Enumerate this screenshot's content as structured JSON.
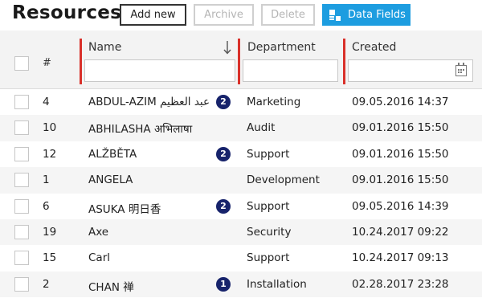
{
  "toolbar": {
    "title": "Resources",
    "add_label": "Add new",
    "archive_label": "Archive",
    "delete_label": "Delete",
    "fields_label": "Data Fields",
    "fields_icon": "data-fields-icon",
    "accent": "#1d9de0"
  },
  "table": {
    "columns": {
      "id": "#",
      "name": "Name",
      "department": "Department",
      "created": "Created"
    },
    "sort": {
      "column": "Name",
      "direction": "descending",
      "icon": "arrow-down-icon"
    },
    "filters": {
      "name": "",
      "department": "",
      "created": "",
      "created_icon": "calendar-icon"
    },
    "separator_color": "#d9302a",
    "badge_color": "#17236b",
    "rows": [
      {
        "id": "4",
        "name": "ABDUL-AZIM عبد العظيم",
        "badge": "2",
        "department": "Marketing",
        "created": "09.05.2016 14:37"
      },
      {
        "id": "10",
        "name": "ABHILASHA अभिलाषा",
        "badge": "",
        "department": "Audit",
        "created": "09.01.2016 15:50"
      },
      {
        "id": "12",
        "name": "ALŽBĚTA",
        "badge": "2",
        "department": "Support",
        "created": "09.01.2016 15:50"
      },
      {
        "id": "1",
        "name": "ANGELA",
        "badge": "",
        "department": "Development",
        "created": "09.01.2016 15:50"
      },
      {
        "id": "6",
        "name": "ASUKA 明日香",
        "badge": "2",
        "department": "Support",
        "created": "09.05.2016 14:39"
      },
      {
        "id": "19",
        "name": "Axe",
        "badge": "",
        "department": "Security",
        "created": "10.24.2017 09:22"
      },
      {
        "id": "15",
        "name": "Carl",
        "badge": "",
        "department": "Support",
        "created": "10.24.2017 09:13"
      },
      {
        "id": "2",
        "name": "CHAN 禅",
        "badge": "1",
        "department": "Installation",
        "created": "02.28.2017 23:28"
      }
    ]
  }
}
